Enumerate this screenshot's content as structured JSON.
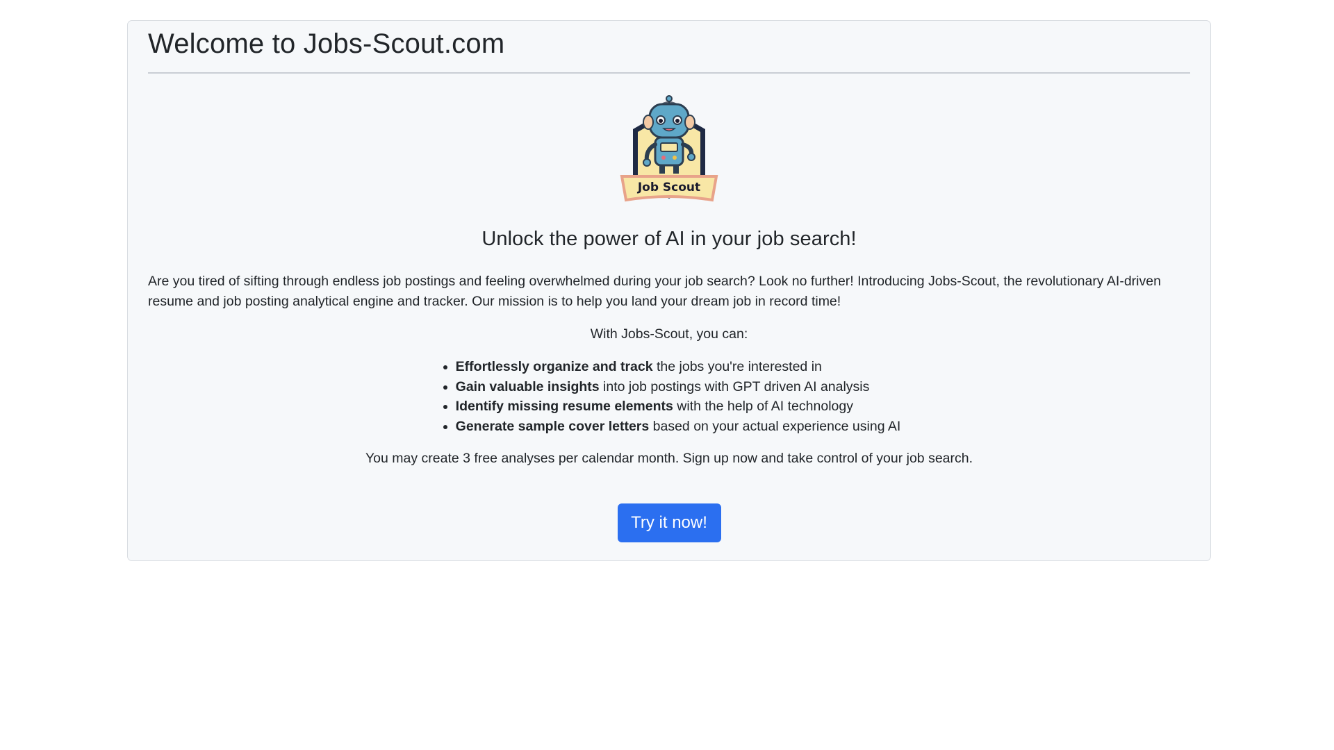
{
  "page": {
    "title": "Welcome to Jobs-Scout.com"
  },
  "logo": {
    "label": "Job Scout",
    "icon": "robot-mascot-icon"
  },
  "hero": {
    "headline": "Unlock the power of AI in your job search!",
    "intro": "Are you tired of sifting through endless job postings and feeling overwhelmed during your job search? Look no further! Introducing Jobs-Scout, the revolutionary AI-driven resume and job posting analytical engine and tracker. Our mission is to help you land your dream job in record time!",
    "lead_in": "With Jobs-Scout, you can:"
  },
  "features": [
    {
      "bold": "Effortlessly organize and track",
      "rest": " the jobs you're interested in"
    },
    {
      "bold": "Gain valuable insights",
      "rest": " into job postings with GPT driven AI analysis"
    },
    {
      "bold": "Identify missing resume elements",
      "rest": " with the help of AI technology"
    },
    {
      "bold": "Generate sample cover letters",
      "rest": " based on your actual experience using AI"
    }
  ],
  "quota_text": "You may create 3 free analyses per calendar month. Sign up now and take control of your job search.",
  "cta": {
    "label": "Try it now!"
  },
  "colors": {
    "card_bg": "#f6f8fa",
    "button": "#2b6ff0",
    "text": "#212529"
  }
}
